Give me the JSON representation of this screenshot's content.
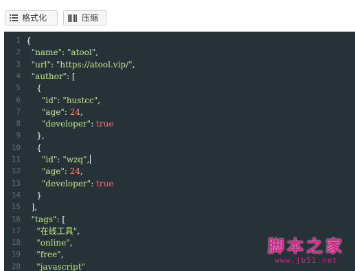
{
  "toolbar": {
    "format_label": "格式化",
    "compress_label": "压缩",
    "format_icon": "list-icon",
    "compress_icon": "barcode-icon"
  },
  "editor": {
    "lines": [
      {
        "n": "1",
        "t": "{"
      },
      {
        "n": "2",
        "t": "  \"name\": \"atool\","
      },
      {
        "n": "3",
        "t": "  \"url\": \"https://atool.vip/\","
      },
      {
        "n": "4",
        "t": "  \"author\": ["
      },
      {
        "n": "5",
        "t": "    {"
      },
      {
        "n": "6",
        "t": "      \"id\": \"hustcc\","
      },
      {
        "n": "7",
        "t": "      \"age\": 24,"
      },
      {
        "n": "8",
        "t": "      \"developer\": true"
      },
      {
        "n": "9",
        "t": "    },"
      },
      {
        "n": "10",
        "t": "    {"
      },
      {
        "n": "11",
        "t": "      \"id\": \"wzq\","
      },
      {
        "n": "12",
        "t": "      \"age\": 24,"
      },
      {
        "n": "13",
        "t": "      \"developer\": true"
      },
      {
        "n": "14",
        "t": "    }"
      },
      {
        "n": "15",
        "t": "  ],"
      },
      {
        "n": "16",
        "t": "  \"tags\": ["
      },
      {
        "n": "17",
        "t": "    \"在线工具\","
      },
      {
        "n": "18",
        "t": "    \"online\","
      },
      {
        "n": "19",
        "t": "    \"free\","
      },
      {
        "n": "20",
        "t": "    \"javascript\""
      }
    ]
  },
  "watermark": {
    "main": "脚本之家",
    "url": "www.jb51.net"
  },
  "colors": {
    "editor_bg": "#263238",
    "string": "#c3e88d",
    "number": "#f78c6c",
    "boolean": "#f07178",
    "line_number": "#5e7178",
    "watermark": "#e0208a"
  }
}
